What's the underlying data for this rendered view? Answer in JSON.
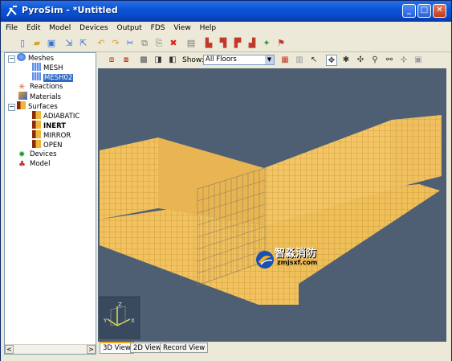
{
  "window": {
    "title": "PyroSim - *Untitled"
  },
  "menu": [
    "File",
    "Edit",
    "Model",
    "Devices",
    "Output",
    "FDS",
    "View",
    "Help"
  ],
  "tree": {
    "meshes": "Meshes",
    "mesh1": "MESH",
    "mesh2": "MESH02",
    "reactions": "Reactions",
    "materials": "Materials",
    "surfaces": "Surfaces",
    "surf1": "ADIABATIC",
    "surf2": "INERT",
    "surf3": "MIRROR",
    "surf4": "OPEN",
    "devices": "Devices",
    "model": "Model"
  },
  "view_toolbar": {
    "show_label": "Show:",
    "show_value": "All Floors"
  },
  "tabs": [
    "3D View",
    "2D View",
    "Record View"
  ],
  "watermark": {
    "text": "智淼消防",
    "url": "zmjsxf.com"
  },
  "colors": {
    "viewport_bg": "#4e5f74",
    "surface": "#f2c25f",
    "selection": "#316ac5"
  }
}
